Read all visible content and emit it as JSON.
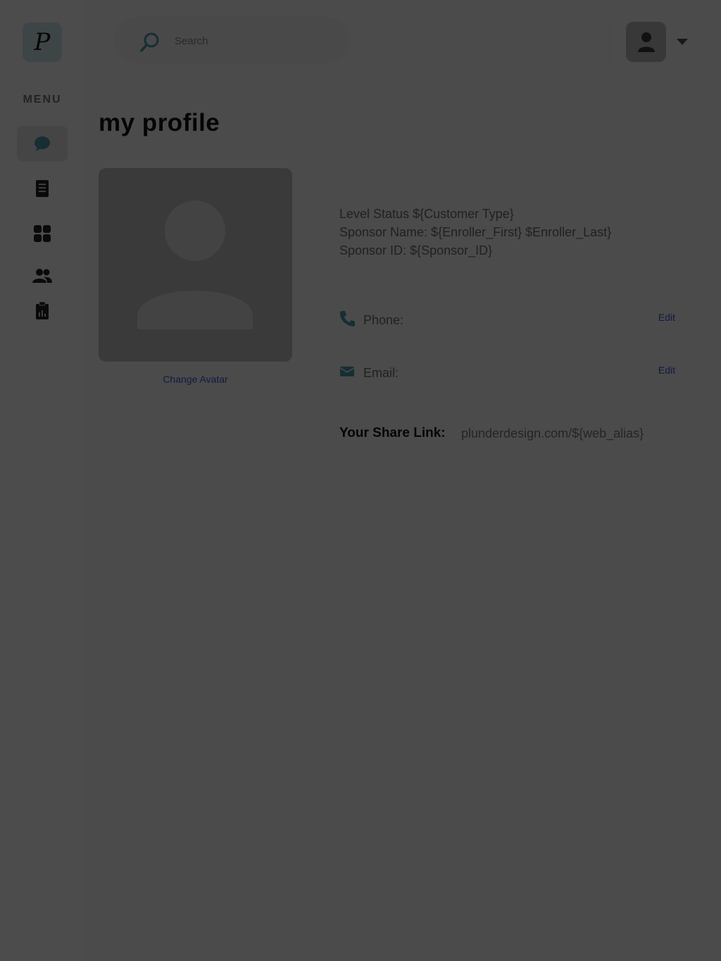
{
  "logo": {
    "glyph": "P"
  },
  "sidebar": {
    "menu_label": "MENU",
    "items": [
      {
        "icon": "chat-bubble-icon",
        "active": true
      },
      {
        "icon": "document-icon",
        "active": false
      },
      {
        "icon": "grid-icon",
        "active": false
      },
      {
        "icon": "users-icon",
        "active": false
      },
      {
        "icon": "clipboard-icon",
        "active": false
      }
    ]
  },
  "header": {
    "search_placeholder": "Search"
  },
  "main": {
    "title": "my profile",
    "change_avatar": "Change Avatar",
    "level_status": "Level Status ${Customer Type}",
    "sponsor_name": "Sponsor Name: ${Enroller_First} $Enroller_Last}",
    "sponsor_id": "Sponsor ID: ${Sponsor_ID}",
    "phone_label": "Phone:",
    "email_label": "Email:",
    "edit_label": "Edit",
    "share_label": "Your Share Link:",
    "share_link": "plunderdesign.com/${web_alias}"
  },
  "colors": {
    "accent_link": "#3c5ad8",
    "icon_teal": "#4a9bb0",
    "overlay": "rgba(0,0,0,0.70)"
  }
}
